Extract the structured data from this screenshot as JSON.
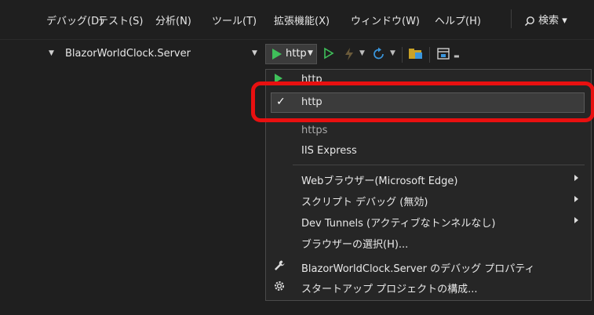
{
  "menubar": {
    "items": [
      {
        "label": "デバッグ(D)"
      },
      {
        "label": "テスト(S)"
      },
      {
        "label": "分析(N)"
      },
      {
        "label": "ツール(T)"
      },
      {
        "label": "拡張機能(X)"
      },
      {
        "label": "ウィンドウ(W)"
      },
      {
        "label": "ヘルプ(H)"
      }
    ],
    "search_label": "検索 ▾"
  },
  "toolbar": {
    "startup_project": "BlazorWorldClock.Server",
    "run_profile": "http"
  },
  "dropdown": {
    "items": [
      {
        "label": "http"
      },
      {
        "label": "http",
        "checked": "✓"
      },
      {
        "label": "https"
      },
      {
        "label": "IIS Express"
      },
      {
        "label": "Webブラウザー(Microsoft Edge)"
      },
      {
        "label": "スクリプト デバッグ (無効)"
      },
      {
        "label": "Dev Tunnels (アクティブなトンネルなし)"
      },
      {
        "label": "ブラウザーの選択(H)..."
      },
      {
        "label": "BlazorWorldClock.Server のデバッグ プロパティ"
      },
      {
        "label": "スタートアップ プロジェクトの構成..."
      }
    ]
  },
  "colors": {
    "accent_green": "#3fc15a",
    "highlight_red": "#e81010",
    "refresh_blue": "#3a96dd"
  },
  "icons": [
    "play-icon",
    "play-outline-icon",
    "hot-reload-icon",
    "refresh-icon",
    "folder-icon",
    "window-icon",
    "search-icon",
    "wrench-icon",
    "gear-icon",
    "checkmark-icon",
    "submenu-arrow-icon"
  ]
}
